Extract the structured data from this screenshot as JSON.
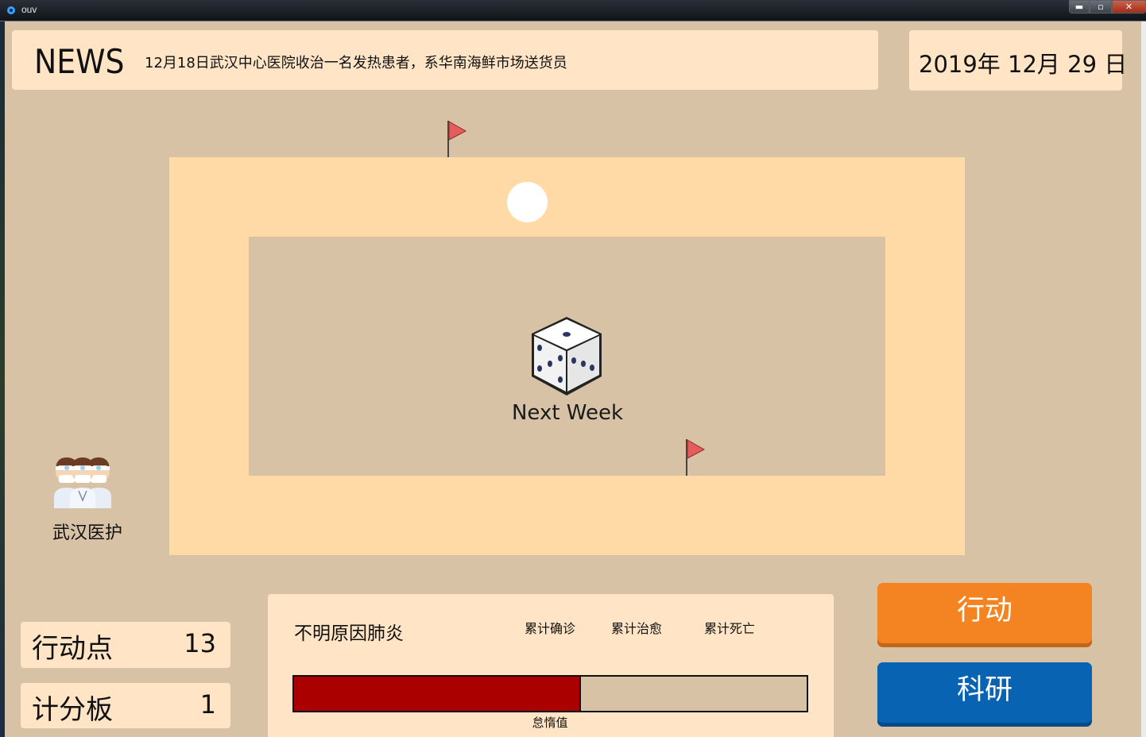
{
  "window": {
    "title": "ouv",
    "minimize_glyph": "▬",
    "maximize_glyph": "▫",
    "close_glyph": "✕"
  },
  "news": {
    "label": "NEWS",
    "headline": "12月18日武汉中心医院收治一名发热患者，系华南海鲜市场送货员"
  },
  "date": {
    "text": "2019年 12月 29 日"
  },
  "board": {
    "next_week_label": "Next Week",
    "flag_color": "#e65c5c",
    "token_color": "#ffffff",
    "dice_icon": "dice-icon"
  },
  "character": {
    "label": "武汉医护",
    "icon": "medical-staff-icon"
  },
  "stats": {
    "action_points_label": "行动点",
    "action_points_value": "13",
    "score_label": "计分板",
    "score_value": "1"
  },
  "disease": {
    "name": "不明原因肺炎",
    "headers": [
      "累计确诊",
      "累计治愈",
      "累计死亡"
    ],
    "idle_label": "怠惰值",
    "idle_fraction": 0.56,
    "idle_color": "#ab0000"
  },
  "buttons": {
    "action_label": "行动",
    "action_color": "#f38421",
    "research_label": "科研",
    "research_color": "#0863b3"
  },
  "colors": {
    "background": "#d7c2a6",
    "panel": "#ffe5c5",
    "track": "#ffdaa6"
  }
}
